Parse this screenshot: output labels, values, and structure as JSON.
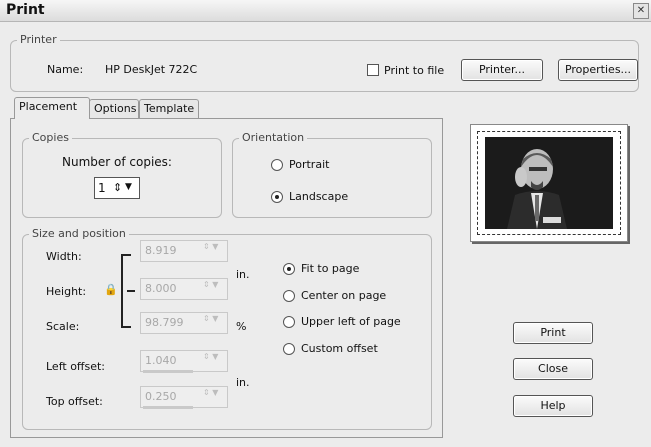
{
  "window": {
    "title": "Print",
    "close_glyph": "✕"
  },
  "printer": {
    "group_label": "Printer",
    "name_label": "Name:",
    "name_value": "HP DeskJet 722C",
    "print_to_file": "Print to file",
    "print_to_file_checked": false,
    "printer_button": "Printer...",
    "properties_button": "Properties..."
  },
  "tabs": [
    {
      "label": "Placement",
      "active": true
    },
    {
      "label": "Options",
      "active": false
    },
    {
      "label": "Template",
      "active": false
    }
  ],
  "copies": {
    "group_label": "Copies",
    "number_label": "Number of copies:",
    "value": "1"
  },
  "orientation": {
    "group_label": "Orientation",
    "portrait": "Portrait",
    "landscape": "Landscape",
    "selected": "landscape"
  },
  "size_position": {
    "group_label": "Size and position",
    "width_label": "Width:",
    "width_value": "8.919",
    "height_label": "Height:",
    "height_value": "8.000",
    "scale_label": "Scale:",
    "scale_value": "98.799",
    "unit_in": "in.",
    "unit_pct": "%",
    "left_offset_label": "Left offset:",
    "left_offset_value": "1.040",
    "top_offset_label": "Top offset:",
    "top_offset_value": "0.250",
    "unit_in_2": "in.",
    "options": [
      "Fit to page",
      "Center on page",
      "Upper left of page",
      "Custom offset"
    ],
    "selected": "Fit to page"
  },
  "actions": {
    "print": "Print",
    "close": "Close",
    "help": "Help"
  },
  "preview": {
    "icon": "photo-preview"
  }
}
